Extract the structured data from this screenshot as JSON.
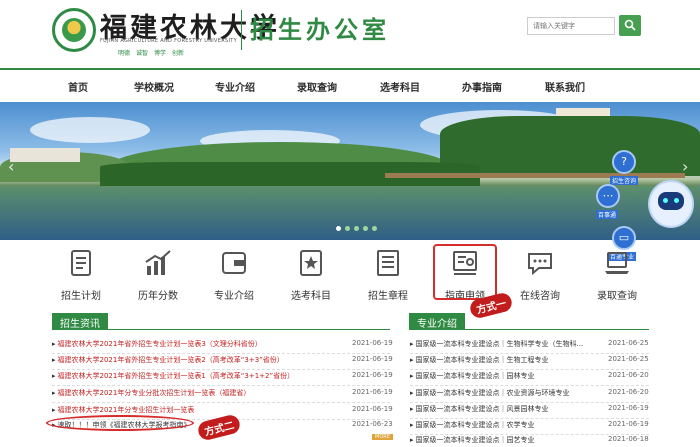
{
  "header": {
    "school_name": "福建农林大学",
    "school_en": "FUJIAN AGRICULTURE AND FORESTRY UNIVERSITY",
    "motto": "明德　诚智　博学　创新",
    "office_name": "招生办公室",
    "search_placeholder": "请输入关键字"
  },
  "nav": [
    "首页",
    "学校概况",
    "专业介绍",
    "录取查询",
    "选考科目",
    "办事指南",
    "联系我们"
  ],
  "floating": {
    "help_label": "招生咨询",
    "info_label": "百事通",
    "guide_label": "百通专业"
  },
  "quick_links": [
    "招生计划",
    "历年分数",
    "专业介绍",
    "选考科目",
    "招生章程",
    "指南申领",
    "在线咨询",
    "录取查询"
  ],
  "annotations": {
    "method_one": "方式一",
    "method_two": "方式二"
  },
  "news": {
    "title": "招生资讯",
    "items": [
      {
        "title": "福建农林大学2021年省外招生专业计划一览表3（文理分科省份）",
        "date": "2021-06-19"
      },
      {
        "title": "福建农林大学2021年省外招生专业计划一览表2（高考改革“3+3”省份）",
        "date": "2021-06-19"
      },
      {
        "title": "福建农林大学2021年省外招生专业计划一览表1（高考改革“3+1+2”省份）",
        "date": "2021-06-19"
      },
      {
        "title": "福建农林大学2021年分专业分批次招生计划一览表（福建省）",
        "date": "2021-06-19"
      },
      {
        "title": "福建农林大学2021年分专业招生计划一览表",
        "date": "2021-06-19"
      },
      {
        "title": "速取！！！申领《福建农林大学报考指南》",
        "date": "2021-06-23"
      }
    ],
    "more": "MORE"
  },
  "majors": {
    "title": "专业介绍",
    "items": [
      {
        "title": "国家级一流本科专业建设点｜生物科学专业（生物科...",
        "date": "2021-06-25"
      },
      {
        "title": "国家级一流本科专业建设点｜生物工程专业",
        "date": "2021-06-25"
      },
      {
        "title": "国家级一流本科专业建设点｜园林专业",
        "date": "2021-06-20"
      },
      {
        "title": "国家级一流本科专业建设点｜农业资源与环境专业",
        "date": "2021-06-20"
      },
      {
        "title": "国家级一流本科专业建设点｜风景园林专业",
        "date": "2021-06-19"
      },
      {
        "title": "国家级一流本科专业建设点｜农学专业",
        "date": "2021-06-19"
      },
      {
        "title": "国家级一流本科专业建设点｜园艺专业",
        "date": "2021-06-18"
      }
    ]
  },
  "colors": {
    "brand_green": "#2f8a43",
    "news_red": "#c41d1d",
    "annotation_red": "#d62c2c"
  }
}
